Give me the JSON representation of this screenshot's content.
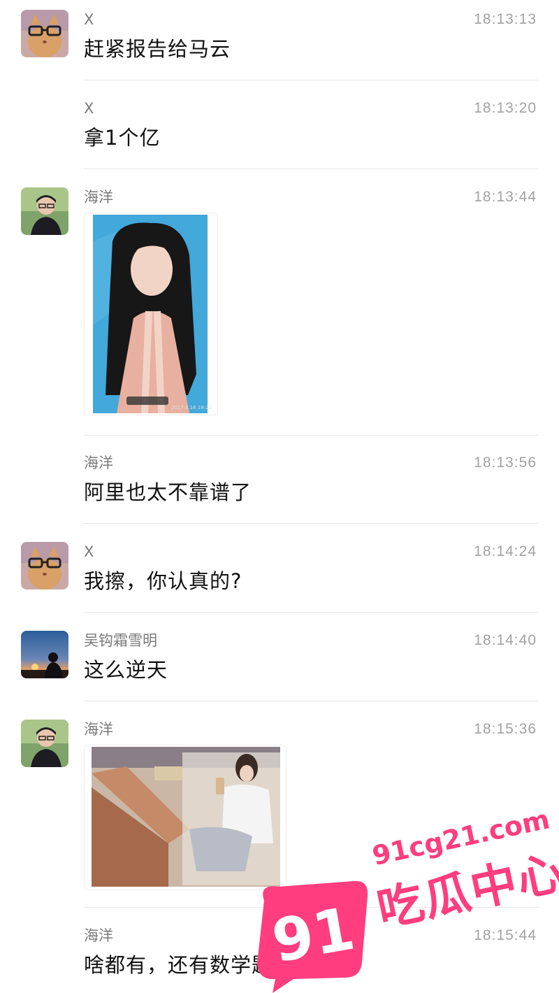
{
  "messages": [
    {
      "sender": "X",
      "time": "18:13:13",
      "text": "赶紧报告给马云",
      "avatar": "cat-glasses-avatar"
    },
    {
      "sender": "X",
      "time": "18:13:20",
      "text": "拿1个亿"
    },
    {
      "sender": "海洋",
      "time": "18:13:44",
      "image": "girl-photo-portrait",
      "avatar": "young-man-avatar",
      "image_caption": "2017.6.16  18:22"
    },
    {
      "sender": "海洋",
      "time": "18:13:56",
      "text": "阿里也太不靠谱了"
    },
    {
      "sender": "X",
      "time": "18:14:24",
      "text": "我擦，你认真的?",
      "avatar": "cat-glasses-avatar"
    },
    {
      "sender": "吴钩霜雪明",
      "time": "18:14:40",
      "text": "这么逆天",
      "avatar": "sunset-silhouette-avatar"
    },
    {
      "sender": "海洋",
      "time": "18:15:36",
      "image": "mirror-selfie-photo",
      "avatar": "young-man-avatar"
    },
    {
      "sender": "海洋",
      "time": "18:15:44",
      "text": "啥都有，还有数学题"
    }
  ],
  "watermark": {
    "number": "91",
    "url": "91cg21.com",
    "name": "吃瓜中心",
    "color": "#ff3d7f"
  }
}
